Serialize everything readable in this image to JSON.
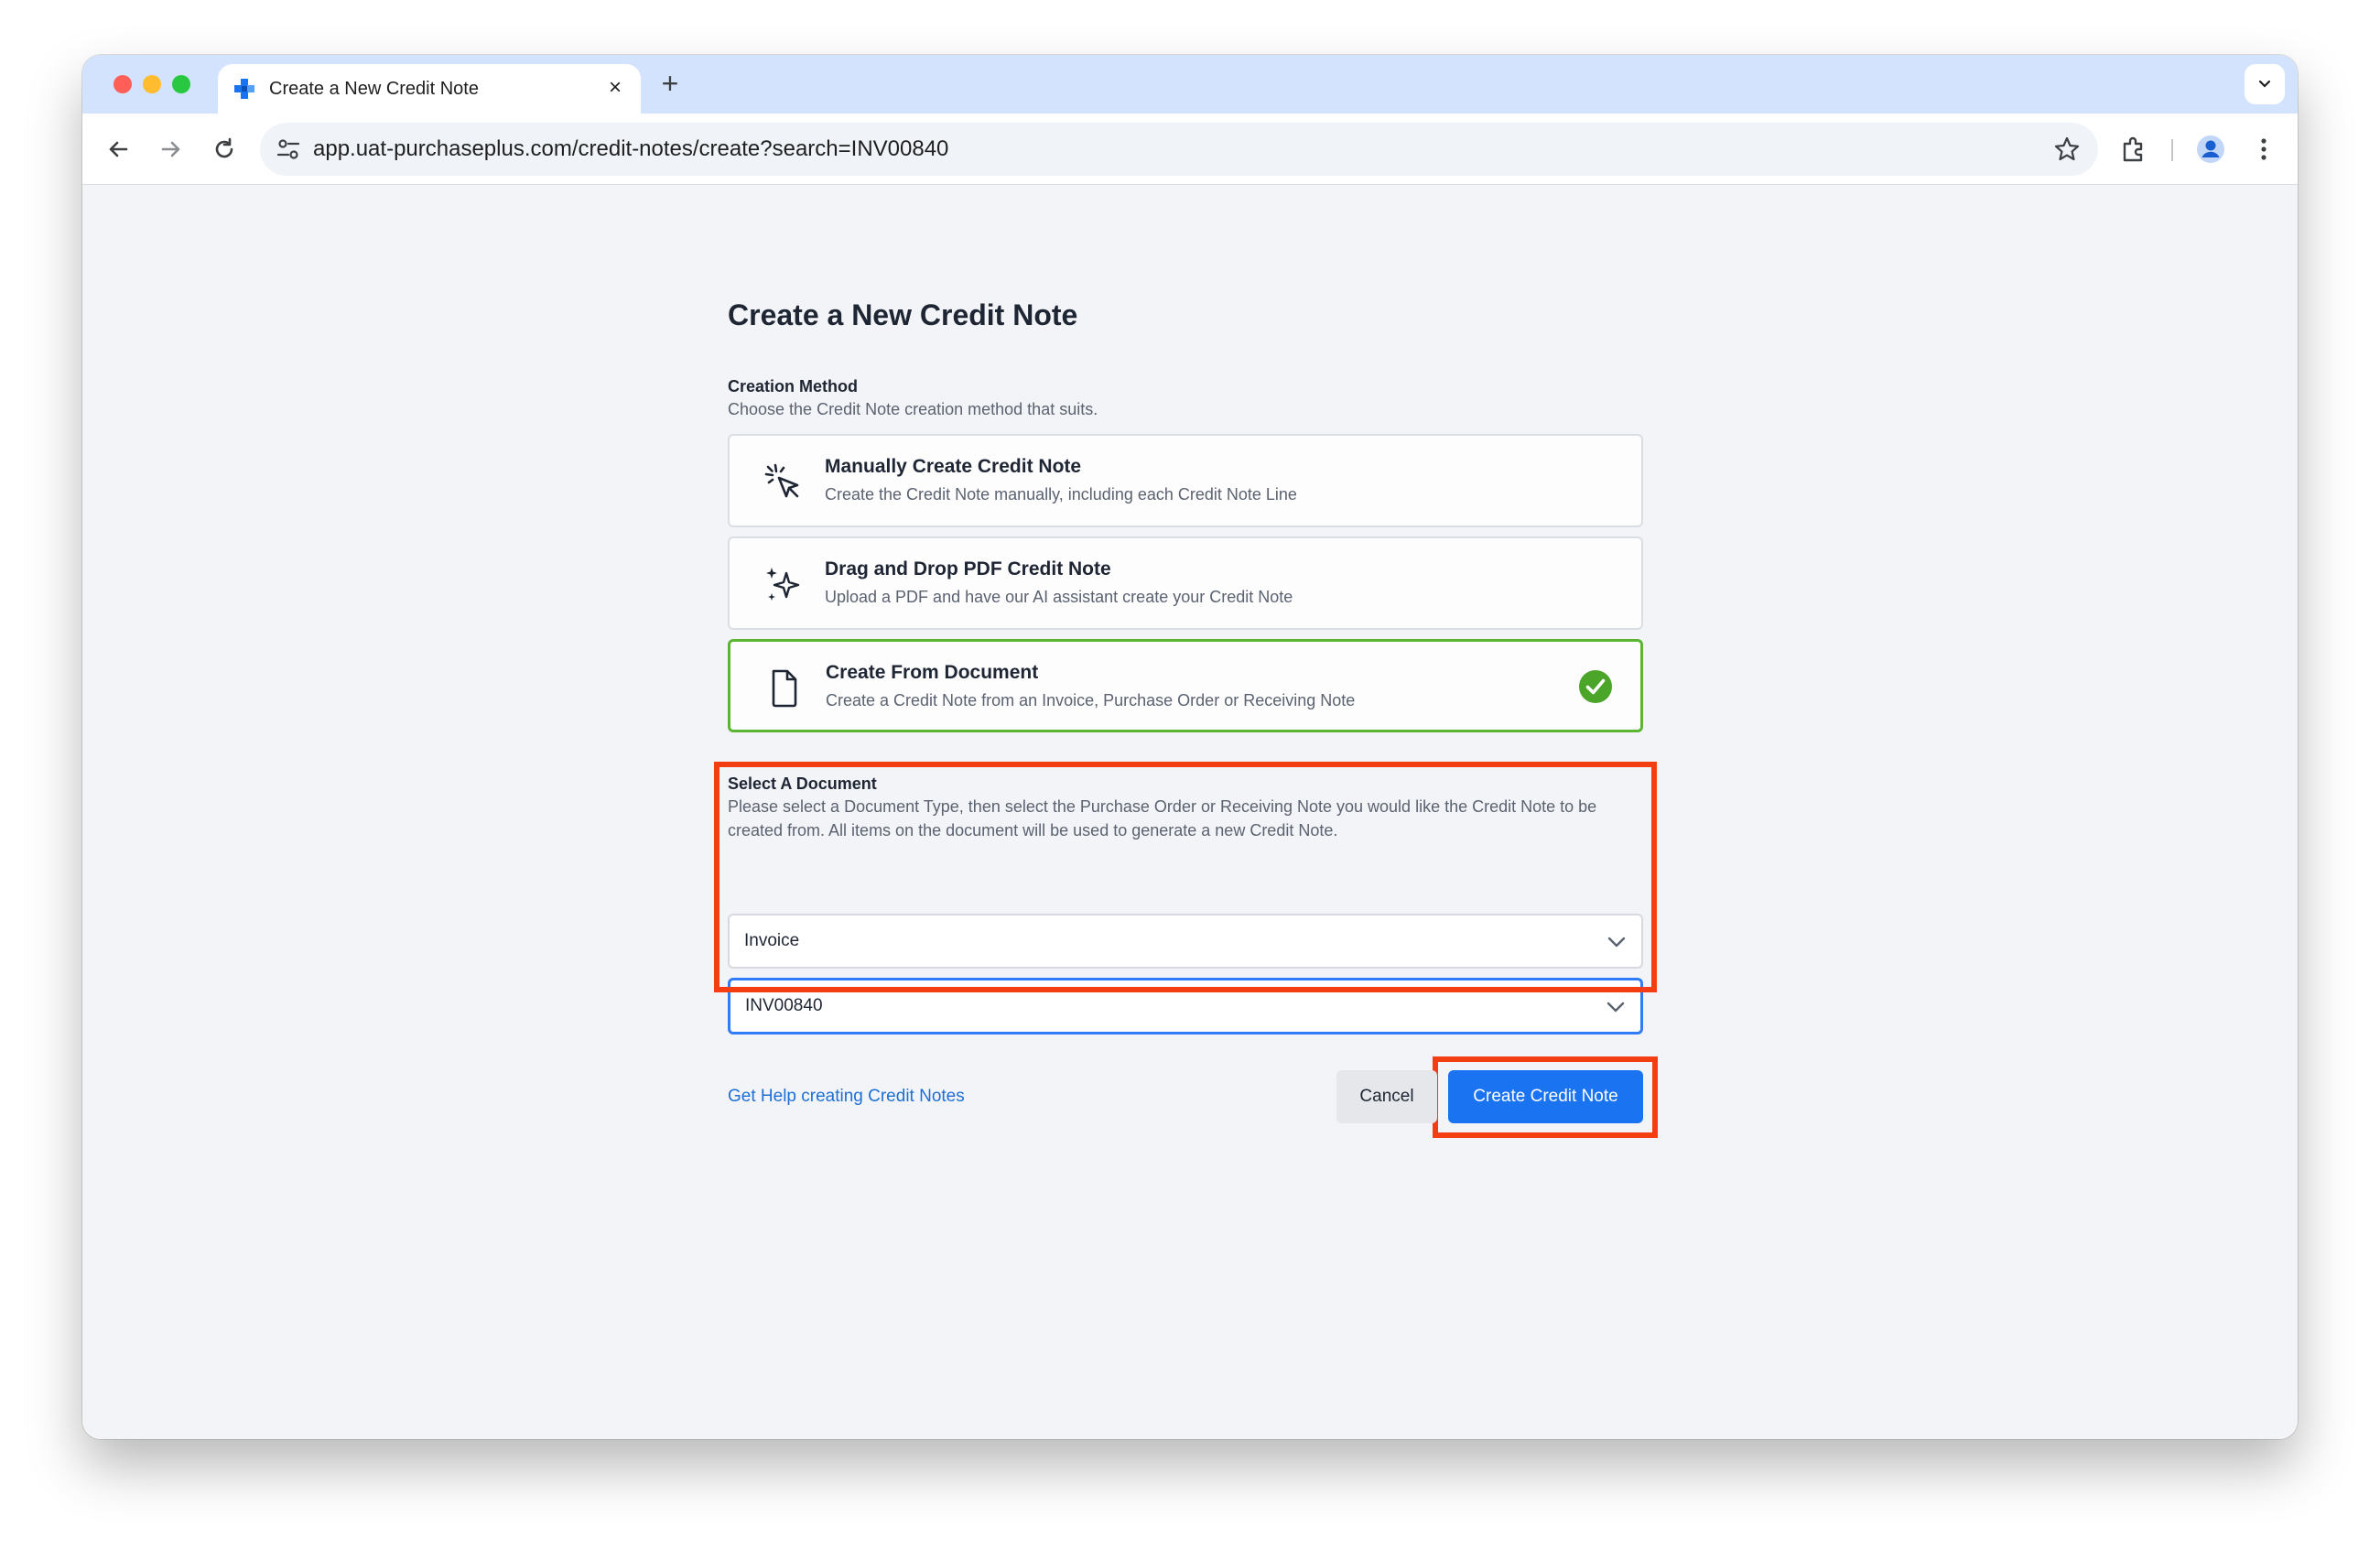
{
  "browser": {
    "tab_title": "Create a New Credit Note",
    "tab_close": "×",
    "new_tab": "+",
    "url": "app.uat-purchaseplus.com/credit-notes/create?search=INV00840"
  },
  "page": {
    "title": "Create a New Credit Note",
    "creation_method": {
      "label": "Creation Method",
      "help": "Choose the Credit Note creation method that suits.",
      "options": [
        {
          "title": "Manually Create Credit Note",
          "description": "Create the Credit Note manually, including each Credit Note Line",
          "icon": "cursor-click-icon",
          "selected": false
        },
        {
          "title": "Drag and Drop PDF Credit Note",
          "description": "Upload a PDF and have our AI assistant create your Credit Note",
          "icon": "sparkles-icon",
          "selected": false
        },
        {
          "title": "Create From Document",
          "description": "Create a Credit Note from an Invoice, Purchase Order or Receiving Note",
          "icon": "document-icon",
          "selected": true
        }
      ]
    },
    "select_document": {
      "label": "Select A Document",
      "help": "Please select a Document Type, then select the Purchase Order or Receiving Note you would like the Credit Note to be created from. All items on the document will be used to generate a new Credit Note.",
      "document_type_value": "Invoice",
      "document_value": "INV00840"
    },
    "help_link": "Get Help creating Credit Notes",
    "cancel_label": "Cancel",
    "create_label": "Create Credit Note"
  },
  "colors": {
    "accent": "#1a73f0",
    "selected_border": "#5cb531",
    "highlight": "#f23e11"
  }
}
